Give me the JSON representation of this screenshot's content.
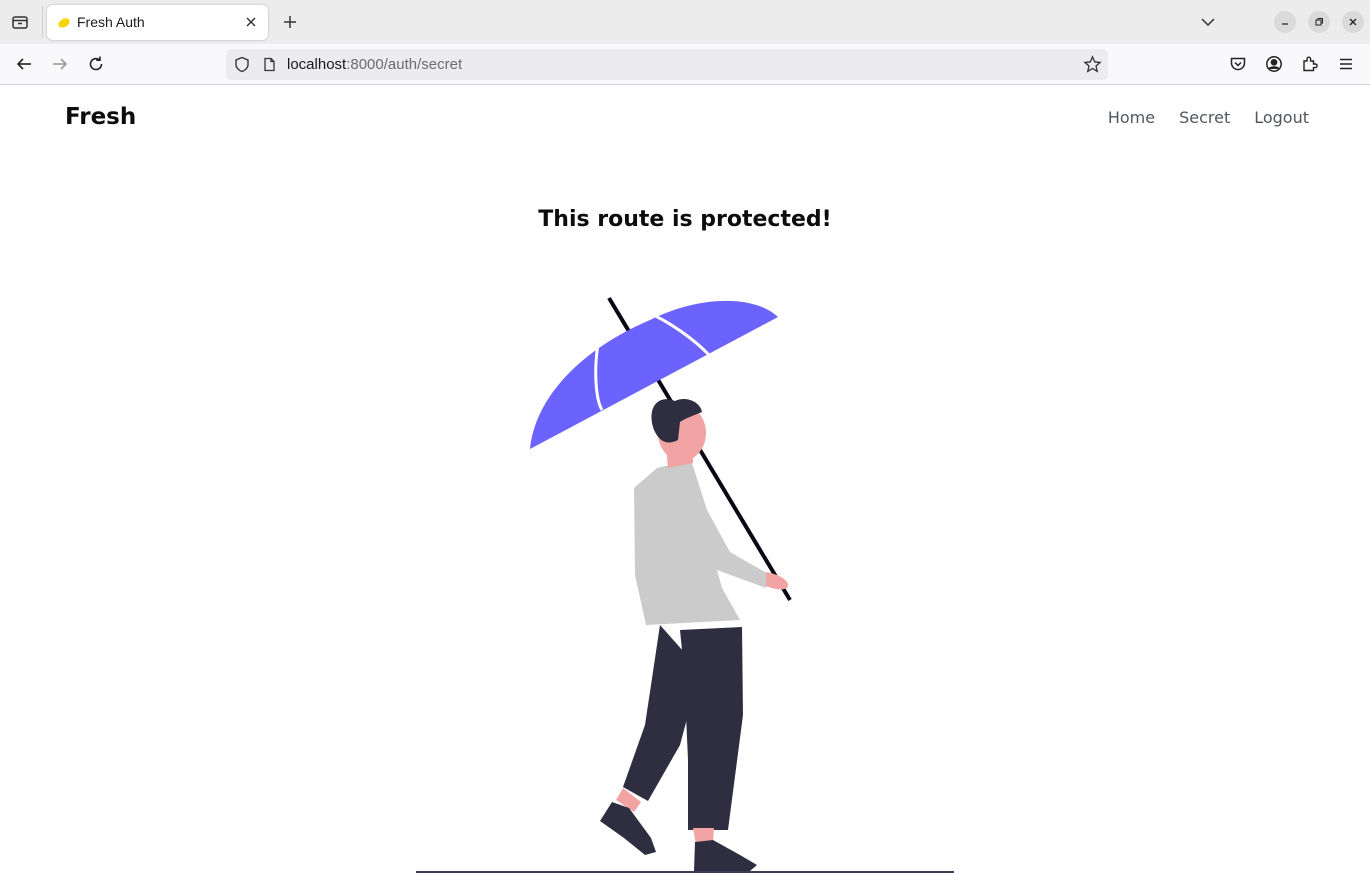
{
  "browser": {
    "tab_title": "Fresh Auth",
    "url_host": "localhost",
    "url_rest": ":8000/auth/secret"
  },
  "site": {
    "brand": "Fresh",
    "nav": [
      "Home",
      "Secret",
      "Logout"
    ]
  },
  "main": {
    "heading": "This route is protected!"
  },
  "colors": {
    "umbrella": "#6c63ff",
    "shirt": "#cbcbcb",
    "pants": "#2f2e41",
    "skin": "#f2a4a4",
    "tab_favicon": "#f5d600"
  },
  "icons": [
    "tab-list-icon",
    "lemon-favicon-icon",
    "close-icon",
    "plus-icon",
    "chevron-down-icon",
    "minimize-icon",
    "restore-icon",
    "window-close-icon",
    "back-arrow-icon",
    "forward-arrow-icon",
    "reload-icon",
    "shield-icon",
    "page-icon",
    "star-icon",
    "pocket-icon",
    "account-icon",
    "extensions-icon",
    "menu-icon"
  ]
}
